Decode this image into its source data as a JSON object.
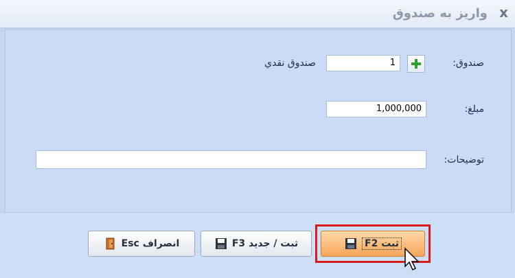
{
  "window": {
    "title": "واريز به صندوق",
    "close_label": "x"
  },
  "form": {
    "box_label": "صندوق:",
    "box_code": "1",
    "box_name": "صندوق نقدي",
    "amount_label": "مبلغ:",
    "amount_value": "1,000,000",
    "desc_label": "توضيحات:",
    "desc_value": ""
  },
  "buttons": {
    "save": "ثبت F2",
    "save_new": "ثبت / جديد F3",
    "cancel": "انصراف Esc"
  },
  "icons": {
    "add": "plus-icon",
    "save": "floppy-icon",
    "save_new": "floppy-icon",
    "cancel": "door-icon"
  },
  "colors": {
    "primary_button": "#f7a65a",
    "highlight": "#d81c1c",
    "plus": "#2fa12f"
  }
}
